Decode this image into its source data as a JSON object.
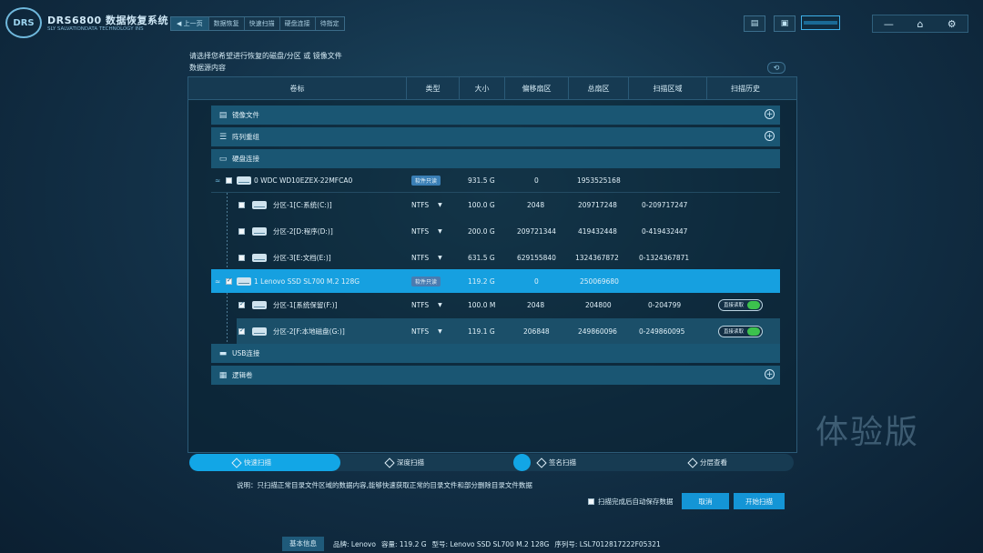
{
  "app": {
    "logo": "DRS",
    "title": "DRS6800 数据恢复系统",
    "subtitle": "SLY SALVATIONDATA TECHNOLOGY INS"
  },
  "breadcrumb": {
    "back": "上一页",
    "items": [
      "数据恢复",
      "快速扫描",
      "硬盘连接",
      "待指定"
    ]
  },
  "toolbar": {
    "icons": [
      "report-icon",
      "briefcase-icon"
    ],
    "window_icons": [
      "minimize-icon",
      "home-icon",
      "gear-icon"
    ]
  },
  "prompt": "请选择您希望进行恢复的磁盘/分区 或 镜像文件",
  "source_label": "数据源内容",
  "columns": [
    "卷标",
    "类型",
    "大小",
    "偏移扇区",
    "总扇区",
    "扫描区域",
    "扫描历史"
  ],
  "groups": {
    "image": "镜像文件",
    "raid": "阵列重组",
    "disk": "硬盘连接",
    "usb": "USB连接",
    "logical": "逻辑卷"
  },
  "disks": [
    {
      "name": "0  WDC WD10EZEX-22MFCA0",
      "badge": "软件只读",
      "size": "931.5 G",
      "offset": "0",
      "total": "1953525168",
      "partitions": [
        {
          "name": "分区-1[C:系统(C:)]",
          "fs": "NTFS",
          "size": "100.0 G",
          "offset": "2048",
          "total": "209717248",
          "range": "0-209717247"
        },
        {
          "name": "分区-2[D:程序(D:)]",
          "fs": "NTFS",
          "size": "200.0 G",
          "offset": "209721344",
          "total": "419432448",
          "range": "0-419432447"
        },
        {
          "name": "分区-3[E:文档(E:)]",
          "fs": "NTFS",
          "size": "631.5 G",
          "offset": "629155840",
          "total": "1324367872",
          "range": "0-1324367871"
        }
      ]
    },
    {
      "name": "1  Lenovo SSD SL700 M.2 128G",
      "badge": "软件只读",
      "size": "119.2 G",
      "offset": "0",
      "total": "250069680",
      "partitions": [
        {
          "name": "分区-1[系统保留(F:)]",
          "fs": "NTFS",
          "size": "100.0 M",
          "offset": "2048",
          "total": "204800",
          "range": "0-204799",
          "toggle": "直接读取"
        },
        {
          "name": "分区-2[F:本地磁盘(G:)]",
          "fs": "NTFS",
          "size": "119.1 G",
          "offset": "206848",
          "total": "249860096",
          "range": "0-249860095",
          "toggle": "直接读取"
        }
      ]
    }
  ],
  "scan_modes": [
    "快速扫描",
    "深度扫描",
    "签名扫描",
    "分层查看"
  ],
  "description": "说明：只扫描正常目录文件区域的数据内容,能够快速获取正常的目录文件和部分删除目录文件数据",
  "autosave": "扫描完成后自动保存数据",
  "buttons": {
    "cancel": "取消",
    "start": "开始扫描"
  },
  "watermark": "体验版",
  "status": {
    "tag": "基本信息",
    "brand": "品牌:  Lenovo",
    "capacity": "容量:   119.2 G",
    "model": "型号:   Lenovo SSD SL700 M.2 128G",
    "serial": "序列号: LSL7012817222F05321"
  },
  "colors": {
    "accent": "#12a6e6",
    "toggle_on": "#3cc24d",
    "group_bg": "#1a5673"
  }
}
